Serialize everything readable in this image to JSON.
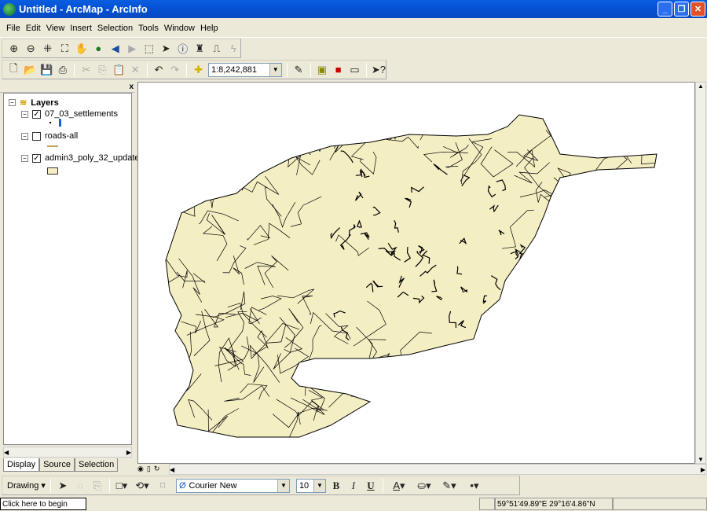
{
  "window": {
    "title": "Untitled - ArcMap - ArcInfo"
  },
  "menu": [
    "File",
    "Edit",
    "View",
    "Insert",
    "Selection",
    "Tools",
    "Window",
    "Help"
  ],
  "tools_toolbar": [
    "zoom-in-icon",
    "zoom-out-icon",
    "fixed-zoom-in-icon",
    "fixed-zoom-out-icon",
    "pan-icon",
    "full-extent-icon",
    "back-icon",
    "forward-icon",
    "select-features-icon",
    "select-elements-icon",
    "identify-icon",
    "find-icon",
    "measure-icon",
    "hyperlink-icon"
  ],
  "standard_toolbar": {
    "scale": "1:8,242,881"
  },
  "toc": {
    "root": "Layers",
    "layers": [
      {
        "name": "07_03_settlements",
        "checked": true,
        "symbol": "point"
      },
      {
        "name": "roads-all",
        "checked": false,
        "symbol": "line",
        "color": "#c8a060"
      },
      {
        "name": "admin3_poly_32_update",
        "checked": true,
        "symbol": "polygon",
        "color": "#f4efc4"
      }
    ],
    "tabs": [
      "Display",
      "Source",
      "Selection"
    ]
  },
  "map": {
    "fill": "#f4eec3",
    "stroke": "#000000"
  },
  "drawing_toolbar": {
    "drawing_label": "Drawing",
    "font": "Courier New",
    "size": "10",
    "bold": "B",
    "italic": "I",
    "underline": "U",
    "font_color_glyph": "A"
  },
  "status": {
    "message": "Click here to begin",
    "coords": "59°51'49.89\"E  29°16'4.86\"N"
  }
}
